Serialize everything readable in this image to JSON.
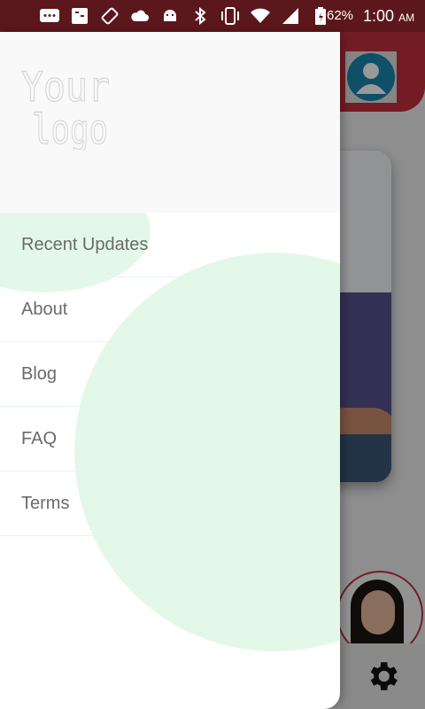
{
  "status_bar": {
    "battery_percent": "62%",
    "time": "1:00",
    "am_pm": "AM",
    "icons": [
      "message-icon",
      "sim-icon",
      "rotate-icon",
      "cloud-icon",
      "android-icon",
      "bluetooth-icon",
      "vibrate-icon",
      "wifi-icon",
      "signal-icon",
      "battery-icon"
    ]
  },
  "drawer": {
    "logo_text_line1": "Your",
    "logo_text_line2": "logo",
    "menu_items": [
      {
        "label": "Recent Updates"
      },
      {
        "label": "About"
      },
      {
        "label": "Blog"
      },
      {
        "label": "FAQ"
      },
      {
        "label": "Terms"
      }
    ]
  },
  "colors": {
    "brand_red": "#c0303c",
    "status_bar": "#5c171c",
    "circle_green": "#e4f8e9",
    "menu_text": "#6a6a6a"
  }
}
